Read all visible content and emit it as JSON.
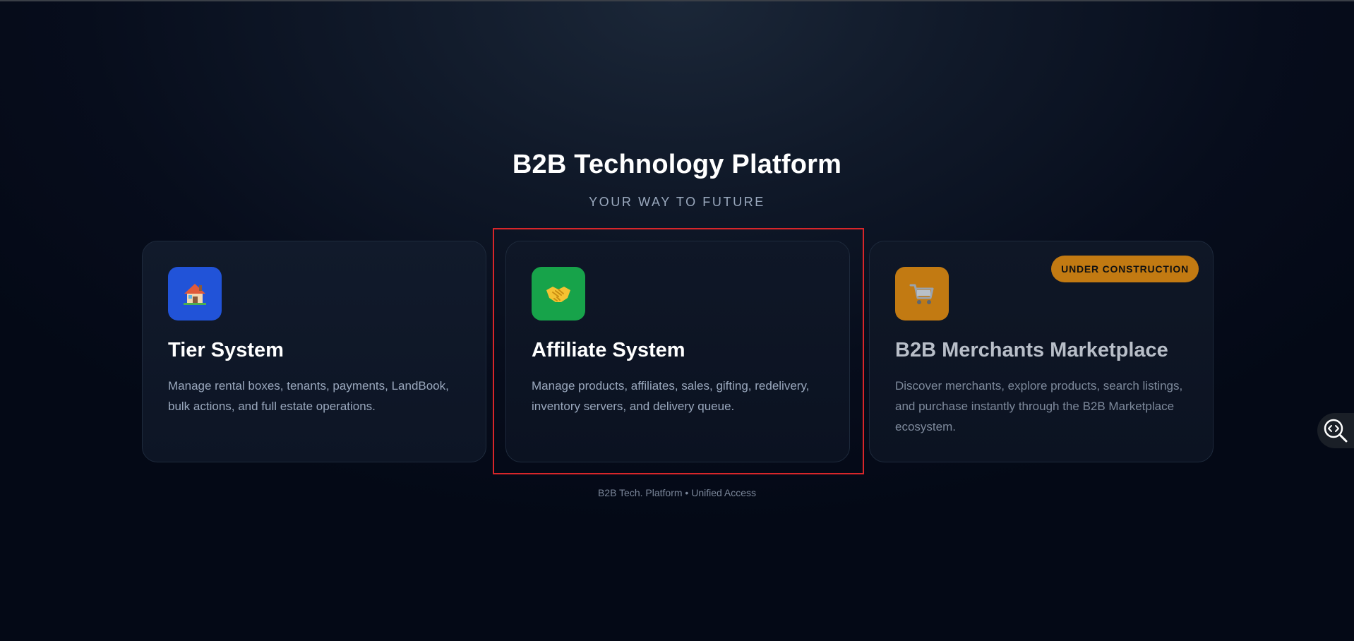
{
  "header": {
    "title": "B2B Technology Platform",
    "subtitle": "YOUR WAY TO FUTURE"
  },
  "cards": [
    {
      "icon": "house-icon",
      "icon_color": "#2153d8",
      "title": "Tier System",
      "description": "Manage rental boxes, tenants, payments, LandBook, bulk actions, and full estate operations."
    },
    {
      "icon": "handshake-icon",
      "icon_color": "#17a34a",
      "title": "Affiliate System",
      "description": "Manage products, affiliates, sales, gifting, redelivery, inventory servers, and delivery queue.",
      "highlight_color": "#d8262a"
    },
    {
      "icon": "shopping-cart-icon",
      "icon_color": "#c27a12",
      "title": "B2B Merchants Marketplace",
      "description": "Discover merchants, explore products, search listings, and purchase instantly through the B2B Marketplace ecosystem.",
      "badge": "UNDER CONSTRUCTION"
    }
  ],
  "footer": {
    "text": "B2B Tech. Platform • Unified Access"
  },
  "side_tool": {
    "icon": "code-search-icon"
  }
}
